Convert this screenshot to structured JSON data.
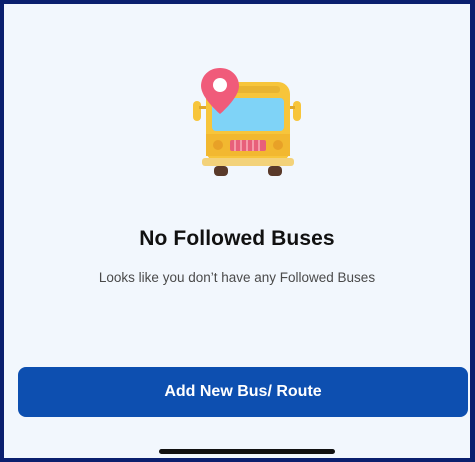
{
  "empty_state": {
    "illustration_icon": "bus-with-location-pin-icon",
    "title": "No Followed Buses",
    "message": "Looks like you don’t have any Followed Buses"
  },
  "actions": {
    "add_button_label": "Add New Bus/ Route"
  },
  "colors": {
    "background": "#f2f7fd",
    "frame_border": "#0a1f6e",
    "primary_button": "#0d4fb0",
    "bus_body": "#f7c53b",
    "bus_window": "#7fd3f7",
    "pin": "#f05b7a"
  }
}
